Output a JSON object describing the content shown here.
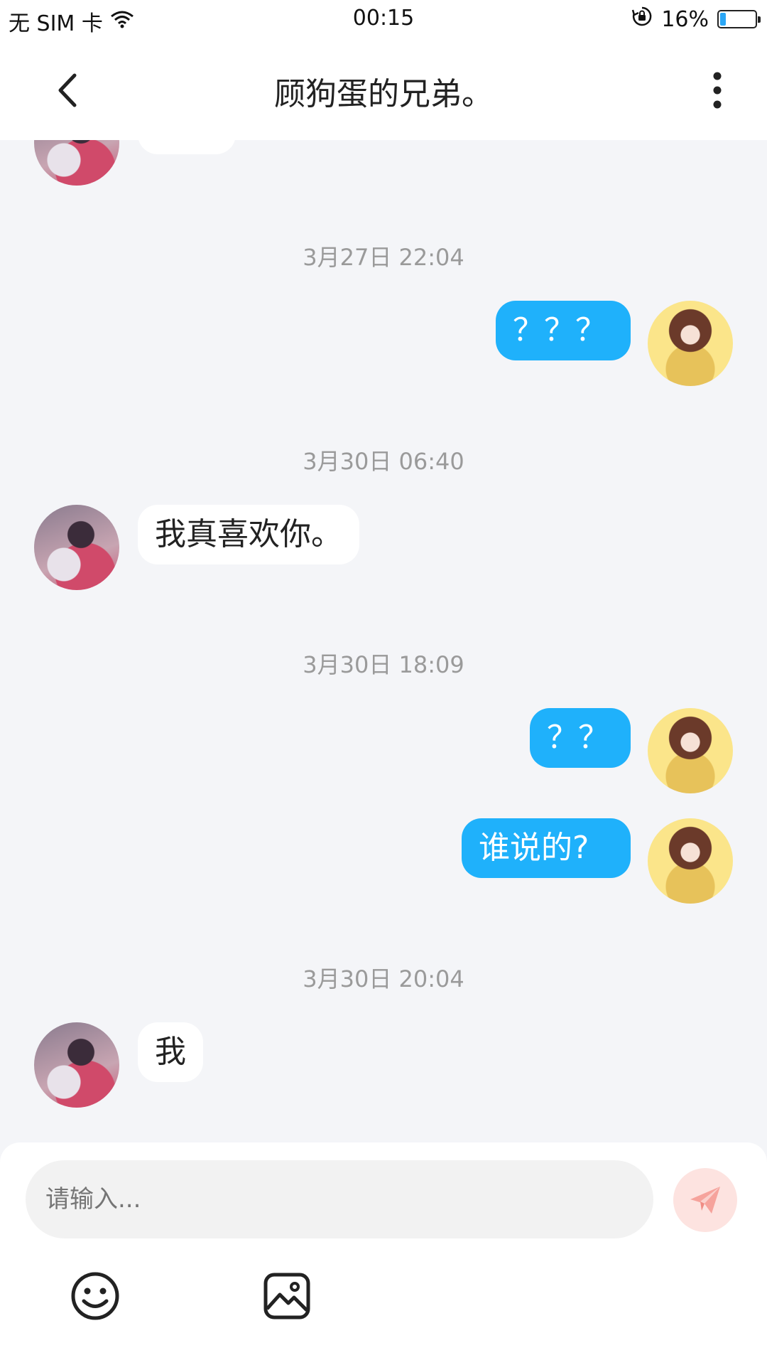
{
  "status_bar": {
    "carrier": "无 SIM 卡",
    "time": "00:15",
    "battery_percent": "16%",
    "battery_level": 0.16
  },
  "header": {
    "title": "顾狗蛋的兄弟。"
  },
  "messages": {
    "ts1": "3月27日 22:04",
    "msg1": "？？？",
    "ts2": "3月30日 06:40",
    "msg2": "我真喜欢你。",
    "ts3": "3月30日 18:09",
    "msg3": "？？",
    "msg4": "谁说的?",
    "ts4": "3月30日 20:04",
    "msg5": "我"
  },
  "input": {
    "placeholder": "请输入..."
  },
  "colors": {
    "sent_bubble": "#1fb1fb",
    "received_bubble": "#ffffff",
    "send_button": "#fde3e0",
    "send_icon": "#f6a39c"
  },
  "icons": {
    "back": "chevron-left-icon",
    "more": "more-vertical-icon",
    "send": "paper-plane-icon",
    "emoji": "smiley-icon",
    "image": "image-icon"
  }
}
